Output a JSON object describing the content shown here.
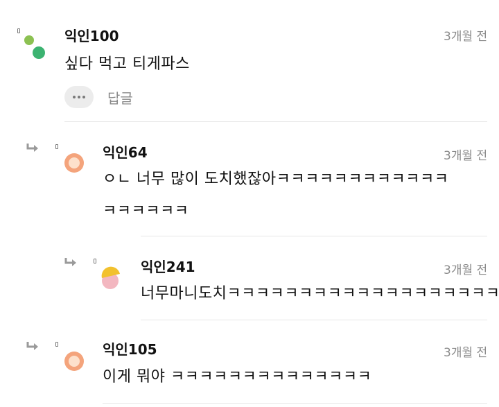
{
  "comments": [
    {
      "nickname": "익인100",
      "time": "3개월 전",
      "lines": [
        "싶다 먹고 티게파스"
      ],
      "more_label": "•••",
      "reply_label": "답글"
    },
    {
      "nickname": "익인64",
      "time": "3개월 전",
      "lines": [
        "ㅇㄴ 너무 많이 도치했잖아ㅋㅋㅋㅋㅋㅋㅋㅋㅋㅋㅋㅋ",
        "ㅋㅋㅋㅋㅋㅋ"
      ]
    },
    {
      "nickname": "익인241",
      "time": "3개월 전",
      "lines": [
        "너무마니도치ㅋㅋㅋㅋㅋㅋㅋㅋㅋㅋㅋㅋㅋㅋㅋㅋㅋㅋㅋ"
      ]
    },
    {
      "nickname": "익인105",
      "time": "3개월 전",
      "lines": [
        "이게 뭐야 ㅋㅋㅋㅋㅋㅋㅋㅋㅋㅋㅋㅋㅋㅋ"
      ]
    }
  ],
  "colors": {
    "avatar_green_light": "#8cc152",
    "avatar_green_dark": "#3cb371",
    "avatar_orange": "#f4a47c",
    "avatar_orange_inner": "#fde1cc",
    "avatar_yellow": "#f2c12e",
    "avatar_pink": "#f3b7c0"
  }
}
